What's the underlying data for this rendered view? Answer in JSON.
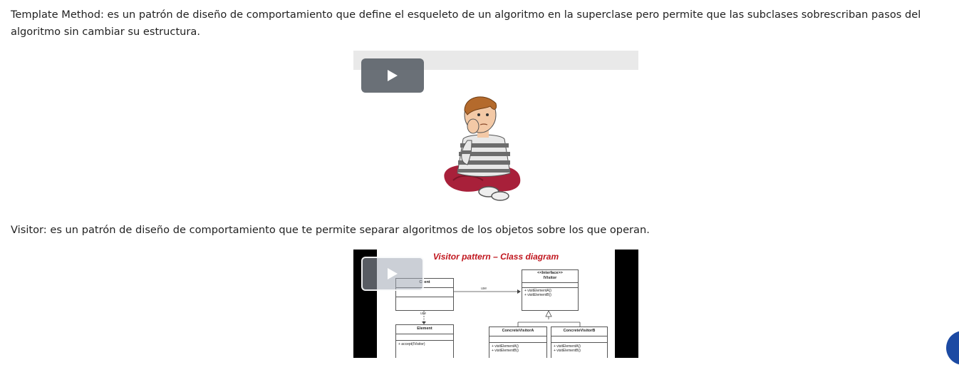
{
  "paragraphs": [
    {
      "term": "Template Method",
      "text": ": es un patrón de diseño de comportamiento que define el esqueleto de un algoritmo en la superclase pero permite que las subclases sobrescriban pasos del algoritmo sin cambiar su estructura."
    },
    {
      "term": "Visitor",
      "text": ": es un patrón de diseño de comportamiento que te permite separar algoritmos de los objetos sobre los que operan."
    }
  ],
  "video2_slide": {
    "title": "Visitor pattern – Class diagram",
    "client_label": "Client",
    "use_label_h": "use",
    "use_label_v": "use",
    "ivisitor_stereotype": "<<Interface>>",
    "ivisitor_name": "IVisitor",
    "ivisitor_ops": [
      "+ visitElementA()",
      "+ visitElementB()"
    ],
    "element_name": "Element",
    "element_ops": [
      "+ accept(IVisitor)"
    ],
    "cva_name": "ConcreteVisitorA",
    "cva_ops": [
      "+ visitElementA()",
      "+ visitElementB()"
    ],
    "cvb_name": "ConcreteVisitorB",
    "cvb_ops": [
      "+ visitElementA()",
      "+ visitElementB()"
    ]
  },
  "colors": {
    "slide_title": "#c0161e",
    "floating_button": "#1c4aa3",
    "play_button": "#5a6068"
  },
  "icons": {
    "play": "play-icon",
    "boy": "thinking-boy-illustration"
  }
}
